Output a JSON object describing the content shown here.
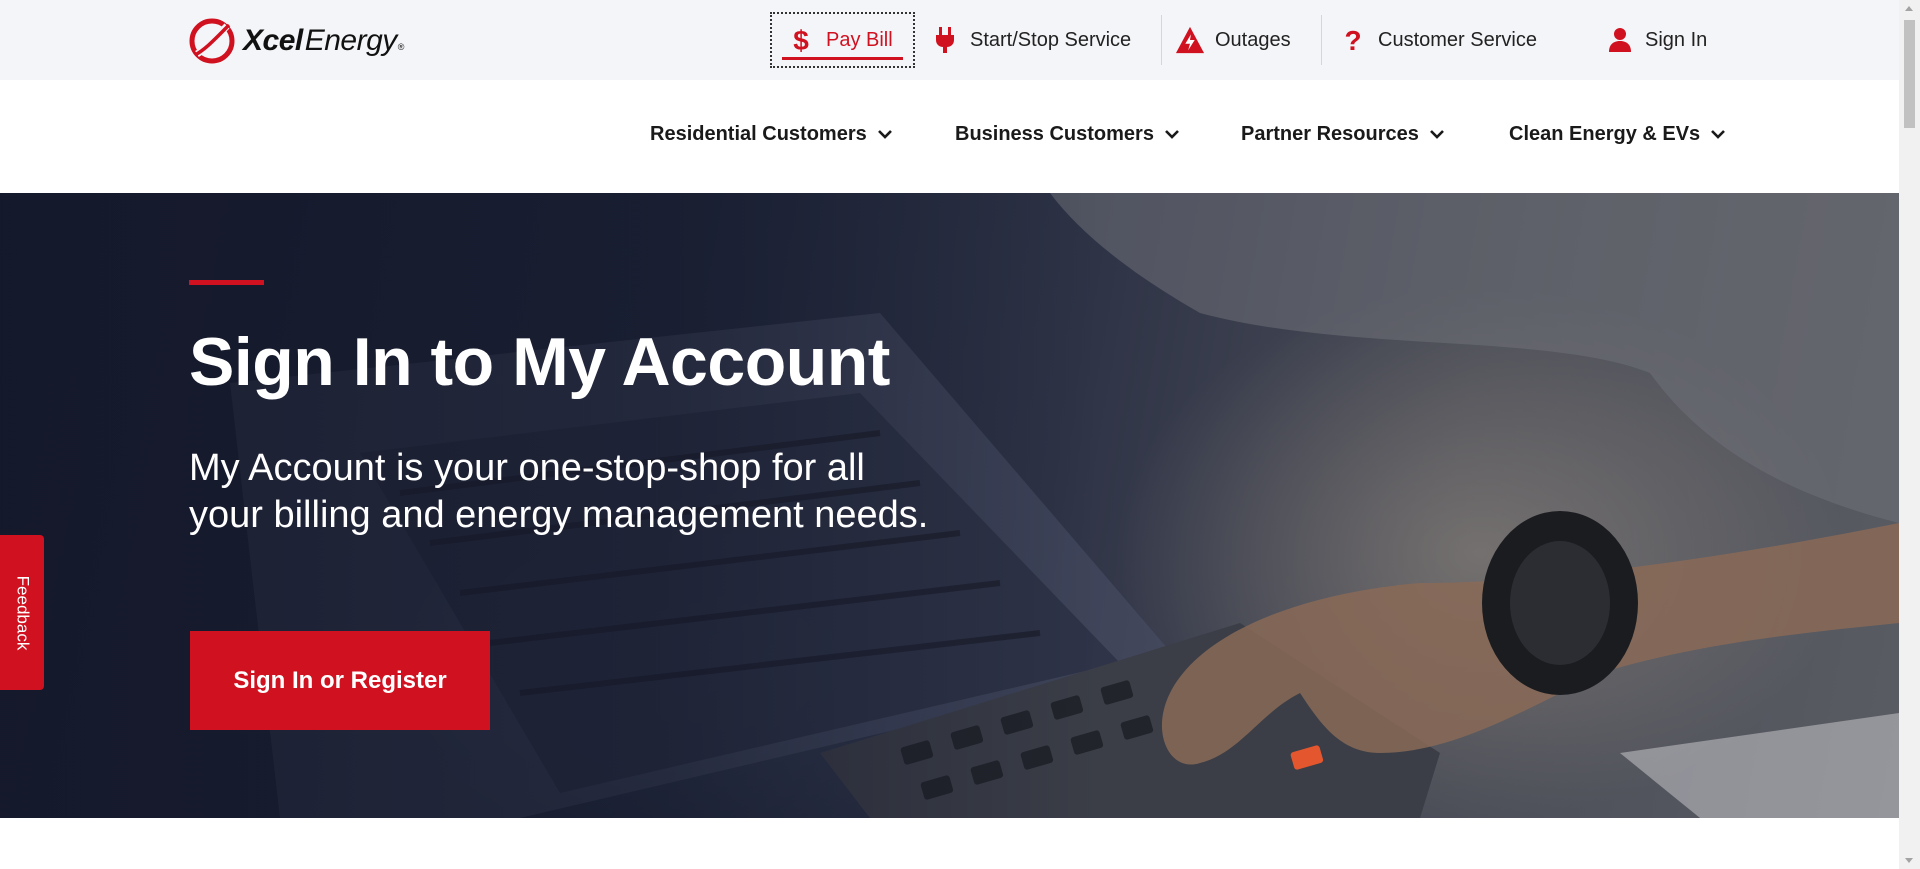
{
  "brand": {
    "name_bold": "Xcel",
    "name_light": "Energy",
    "registered": "®",
    "accent_color": "#d0111f"
  },
  "utility_nav": {
    "pay_bill": {
      "label": "Pay Bill",
      "icon": "dollar-icon"
    },
    "start_stop": {
      "label": "Start/Stop Service",
      "icon": "plug-icon"
    },
    "outages": {
      "label": "Outages",
      "icon": "lightning-warning-icon"
    },
    "customer_service": {
      "label": "Customer Service",
      "icon": "question-icon"
    },
    "sign_in": {
      "label": "Sign In",
      "icon": "user-icon"
    }
  },
  "main_nav": {
    "items": [
      {
        "label": "Residential Customers"
      },
      {
        "label": "Business Customers"
      },
      {
        "label": "Partner Resources"
      },
      {
        "label": "Clean Energy & EVs"
      }
    ]
  },
  "hero": {
    "title": "Sign In to My Account",
    "subtitle": "My Account is your one-stop-shop for all your billing and energy management needs.",
    "cta_label": "Sign In or Register"
  },
  "feedback": {
    "label": "Feedback"
  }
}
